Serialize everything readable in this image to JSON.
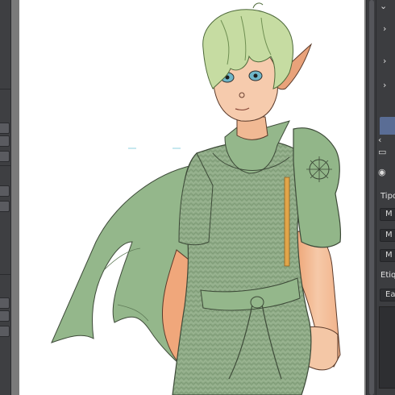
{
  "left_panel": {
    "icons": [
      "trash-icon",
      "brush-icon",
      "move-icon",
      "zoom-icon",
      "dropdown-icon"
    ]
  },
  "right_panel": {
    "section_type_label": "Tipo",
    "section_tags_label": "Etiqu",
    "buttons": [
      "M",
      "M",
      "M"
    ],
    "bottom_button": "Ea"
  },
  "colors": {
    "canvas_bg": "#ffffff",
    "panel_bg": "#3c3d40",
    "accent_tab": "#5a6d95",
    "tunic": "#8fad85",
    "skin": "#f2b78f",
    "hair": "#c8dca6"
  }
}
